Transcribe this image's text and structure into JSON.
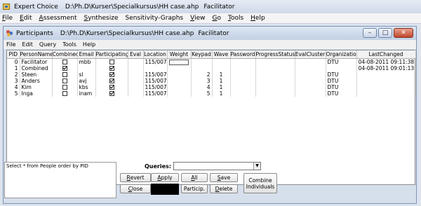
{
  "app": {
    "title": "Expert Choice",
    "file_path": "D:\\Ph.D\\Kurser\\Specialkursus\\HH case.ahp",
    "session": "Facilitator"
  },
  "menu": [
    {
      "label": "File",
      "ul": "F",
      "rest": "ile"
    },
    {
      "label": "Edit",
      "ul": "E",
      "rest": "dit"
    },
    {
      "label": "Assessment",
      "ul": "A",
      "rest": "ssessment"
    },
    {
      "label": "Synthesize",
      "ul": "S",
      "rest": "ynthesize"
    },
    {
      "label": "Sensitivity-Graphs",
      "ul": "",
      "rest": "Sensitivity-Graphs"
    },
    {
      "label": "View",
      "ul": "V",
      "rest": "iew"
    },
    {
      "label": "Go",
      "ul": "G",
      "rest": "o"
    },
    {
      "label": "Tools",
      "ul": "T",
      "rest": "ools"
    },
    {
      "label": "Help",
      "ul": "H",
      "rest": "elp"
    }
  ],
  "participants_window": {
    "title": "Participants",
    "file_path": "D:\\Ph.D\\Kurser\\Specialkursus\\HH case.ahp",
    "session": "Facilitator",
    "menu": [
      "File",
      "Edit",
      "Query",
      "Tools",
      "Help"
    ],
    "window_buttons": {
      "minimize": "–",
      "maximize": "□",
      "close": "✕"
    }
  },
  "table": {
    "columns": [
      "PID",
      "PersonName",
      "Combined",
      "Email",
      "Participating",
      "Eval",
      "Location",
      "Weight",
      "Keypad",
      "Wave",
      "Password",
      "ProgressStatus",
      "EvalCluster",
      "Organization",
      "LastChanged"
    ],
    "rows": [
      {
        "pid": "0",
        "name": "Facilitator",
        "combined": false,
        "email": "mbb",
        "participating": false,
        "eval": "",
        "location": "115/007",
        "weight": "",
        "keypad": "",
        "wave": "",
        "password": "",
        "progress": "",
        "evalcluster": "",
        "org": "DTU",
        "changed": "04-08-2011 09:11:38"
      },
      {
        "pid": "1",
        "name": "Combined",
        "combined": true,
        "email": "",
        "participating": true,
        "eval": "",
        "location": "",
        "weight": "",
        "keypad": "",
        "wave": "",
        "password": "",
        "progress": "",
        "evalcluster": "",
        "org": "",
        "changed": "04-08-2011 09:01:13"
      },
      {
        "pid": "2",
        "name": "Steen",
        "combined": false,
        "email": "sl",
        "participating": true,
        "eval": "",
        "location": "115/007",
        "weight": "",
        "keypad": "2",
        "wave": "1",
        "password": "",
        "progress": "",
        "evalcluster": "",
        "org": "DTU",
        "changed": ""
      },
      {
        "pid": "3",
        "name": "Anders",
        "combined": false,
        "email": "avj",
        "participating": true,
        "eval": "",
        "location": "115/007",
        "weight": "",
        "keypad": "3",
        "wave": "1",
        "password": "",
        "progress": "",
        "evalcluster": "",
        "org": "DTU",
        "changed": ""
      },
      {
        "pid": "4",
        "name": "Kim",
        "combined": false,
        "email": "kbs",
        "participating": true,
        "eval": "",
        "location": "115/007",
        "weight": "",
        "keypad": "4",
        "wave": "1",
        "password": "",
        "progress": "",
        "evalcluster": "",
        "org": "DTU",
        "changed": ""
      },
      {
        "pid": "5",
        "name": "Inga",
        "combined": false,
        "email": "inam",
        "participating": true,
        "eval": "",
        "location": "115/007",
        "weight": "",
        "keypad": "5",
        "wave": "1",
        "password": "",
        "progress": "",
        "evalcluster": "",
        "org": "DTU",
        "changed": ""
      }
    ]
  },
  "query_panel": {
    "sql": "Select * from People order by PID",
    "queries_label": "Queries:",
    "queries_value": ""
  },
  "buttons": {
    "revert": {
      "ul": "R",
      "rest": "evert"
    },
    "apply": {
      "ul": "A",
      "rest": "pply"
    },
    "all": {
      "ul": "A",
      "rest": "ll"
    },
    "save": {
      "ul": "S",
      "rest": "ave"
    },
    "close": {
      "ul": "C",
      "rest": "lose"
    },
    "particip": {
      "ul": "",
      "rest": "Particip."
    },
    "delete": {
      "ul": "D",
      "rest": "elete"
    },
    "combine_line1": "Combine",
    "combine_line2": "Individuals"
  }
}
